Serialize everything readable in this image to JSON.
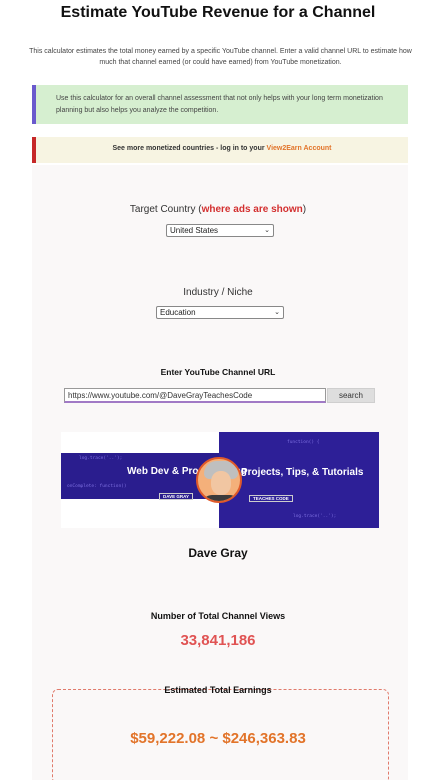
{
  "page": {
    "title": "Estimate YouTube Revenue for a Channel",
    "intro": "This calculator estimates the total money earned by a specific YouTube channel. Enter a valid channel URL to estimate how much that channel earned (or could have earned) from YouTube monetization."
  },
  "notes": {
    "green": "Use this calculator for an overall channel assessment that not only helps with your long term monetization planning but also helps you analyze the competition.",
    "yellow_text": "See more monetized countries - log in to your ",
    "yellow_link": "View2Earn Account"
  },
  "form": {
    "country_label": "Target Country (",
    "country_label_emph": "where ads are shown",
    "country_label_end": ")",
    "country_value": "United States",
    "niche_label": "Industry / Niche",
    "niche_value": "Education",
    "url_label": "Enter YouTube Channel URL",
    "url_value": "https://www.youtube.com/@DaveGrayTeachesCode",
    "search_label": "search"
  },
  "banner": {
    "left_text": "Web Dev & Programming",
    "left_tag": "DAVE GRAY",
    "right_text": "Projects, Tips, & Tutorials",
    "right_tag": "TEACHES CODE"
  },
  "channel": {
    "name": "Dave Gray",
    "views_label": "Number of Total Channel Views",
    "views_value": "33,841,186",
    "earnings_label": "Estimated Total Earnings",
    "earnings_value": "$59,222.08 ~ $246,363.83"
  },
  "colors": {
    "accent_red": "#e05353",
    "accent_orange": "#e2742a",
    "banner_blue": "#2a1d8e"
  }
}
